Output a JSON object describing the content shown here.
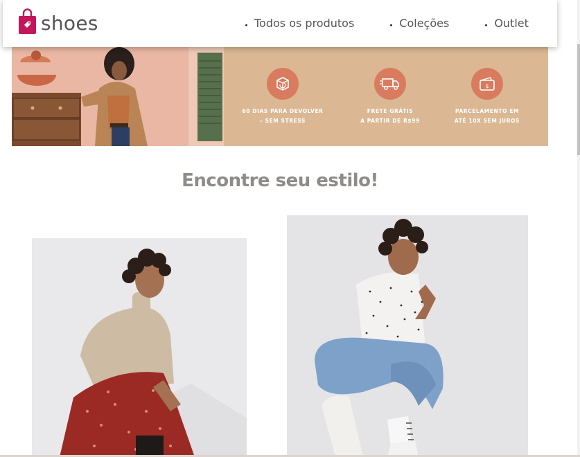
{
  "brand": {
    "name": "shoes",
    "accent_color": "#c2185b"
  },
  "nav": {
    "items": [
      {
        "label": "Todos os produtos"
      },
      {
        "label": "Coleções"
      },
      {
        "label": "Outlet"
      }
    ]
  },
  "banner": {
    "background_color": "#dbb893",
    "perks": [
      {
        "icon": "box-return-icon",
        "text": "60 DIAS PARA DEVOLVER\n– SEM STRESS"
      },
      {
        "icon": "delivery-truck-icon",
        "text": "FRETE GRÁTIS\nA PARTIR DE R$99"
      },
      {
        "icon": "wallet-icon",
        "text": "PARCELAMENTO EM\nATÉ 10X SEM JUROS"
      }
    ]
  },
  "section": {
    "title": "Encontre seu estilo!"
  }
}
